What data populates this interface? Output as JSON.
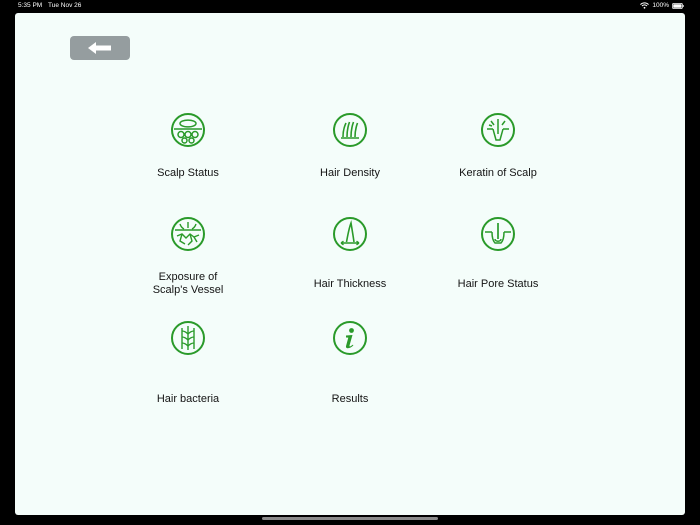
{
  "status_bar": {
    "time": "5:35 PM",
    "date": "Tue Nov 26",
    "battery": "100%"
  },
  "colors": {
    "accent": "#2a9a2a",
    "background": "#f4fdfa",
    "back_button": "#959d9f"
  },
  "back_button": {
    "icon": "arrow-left-icon"
  },
  "menu": {
    "items": [
      {
        "label": "Scalp Status",
        "icon": "scalp-status-icon"
      },
      {
        "label": "Hair Density",
        "icon": "hair-density-icon"
      },
      {
        "label": "Keratin of Scalp",
        "icon": "keratin-icon"
      },
      {
        "label": "Exposure of\nScalp's Vessel",
        "icon": "scalp-vessel-icon"
      },
      {
        "label": "Hair Thickness",
        "icon": "hair-thickness-icon"
      },
      {
        "label": "Hair Pore Status",
        "icon": "hair-pore-icon"
      },
      {
        "label": "Hair bacteria",
        "icon": "hair-bacteria-icon"
      },
      {
        "label": "Results",
        "icon": "info-icon"
      }
    ]
  }
}
